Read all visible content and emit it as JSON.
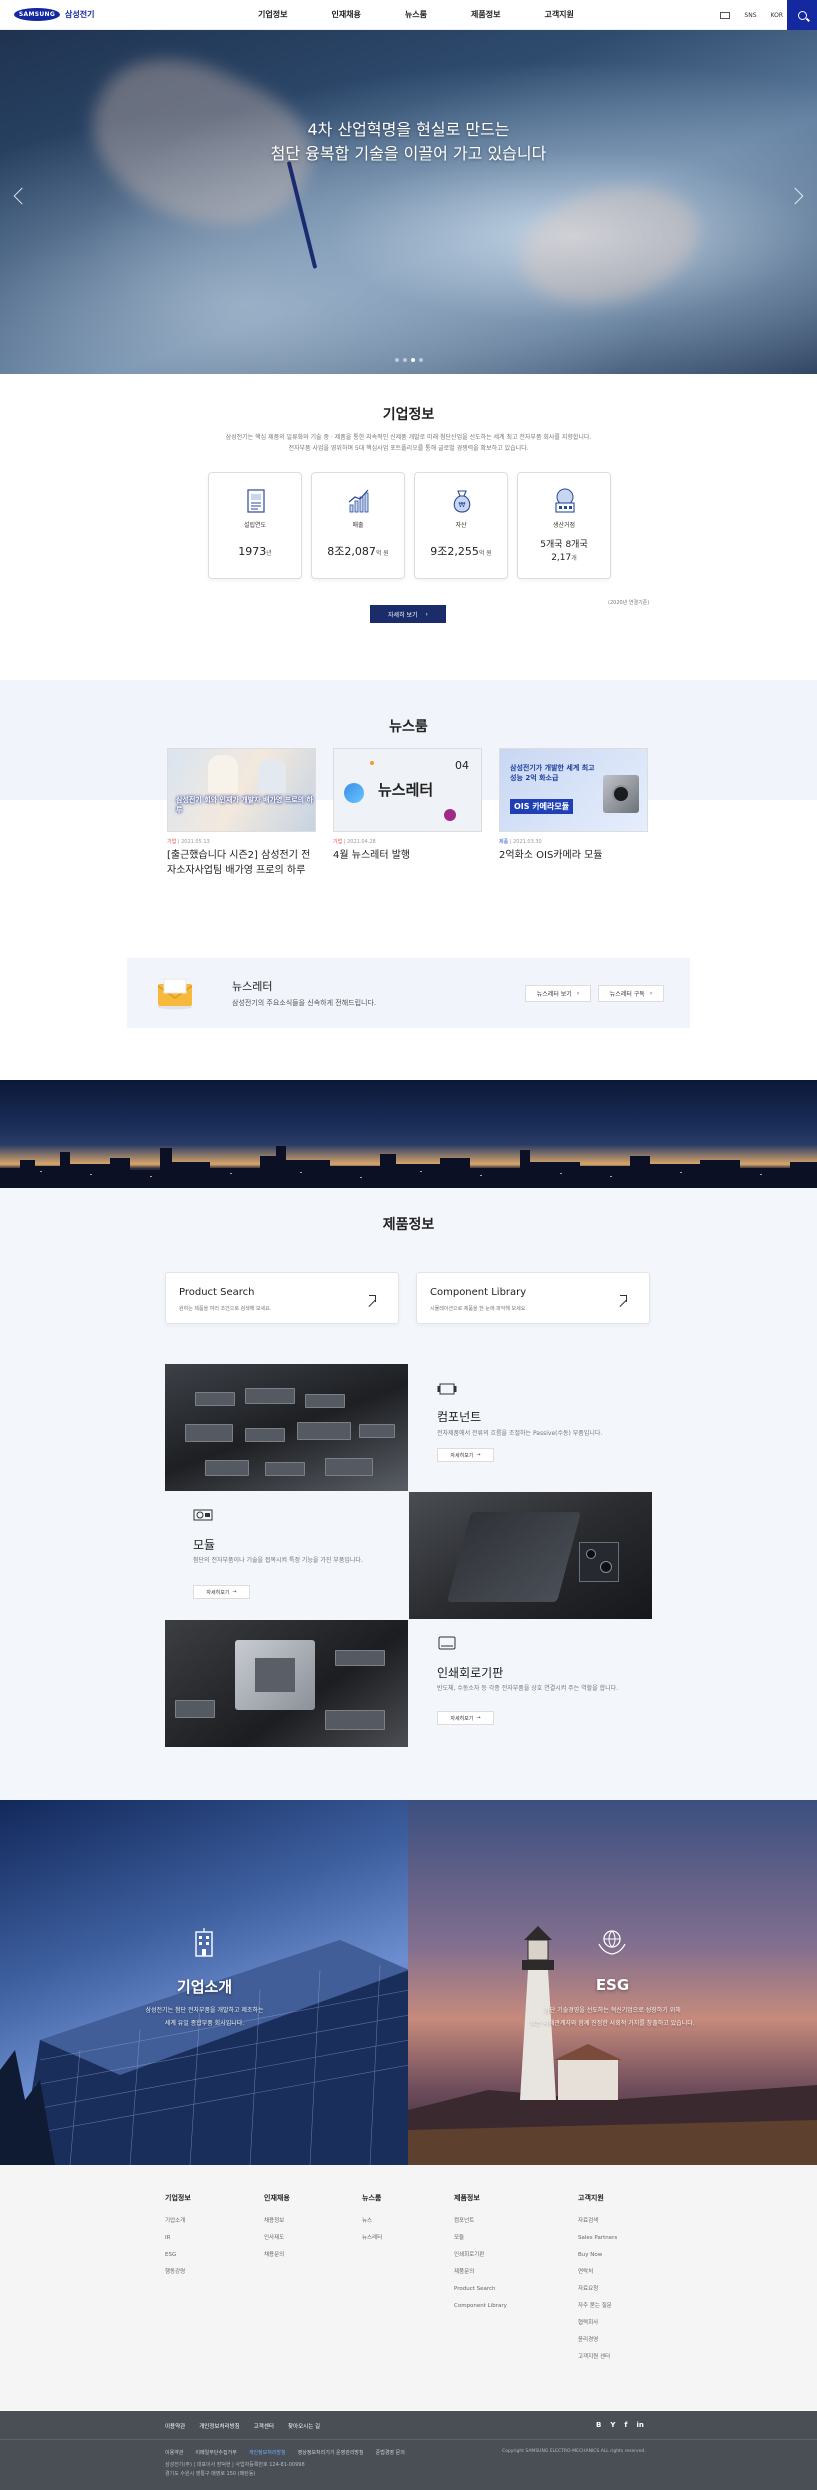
{
  "header": {
    "logo_brand": "SAMSUNG",
    "logo_text": "삼성전기",
    "gnb": [
      "기업정보",
      "인재채용",
      "뉴스룸",
      "제품정보",
      "고객지원"
    ],
    "utils": [
      "SNS",
      "KOR"
    ],
    "accent_color": "#1428a0"
  },
  "hero": {
    "title_line1": "4차 산업혁명을 현실로 만드는",
    "title_line2": "첨단 융복합 기술을 이끌어 가고 있습니다",
    "slides_total": 4,
    "slide_active": 3
  },
  "corp_info": {
    "title": "기업정보",
    "desc_line1": "삼성전기는 핵심 제품의 일류화와 기술 중 · 제품을 통한 지속적인 신제품 개발로 미래 첨단산업을 선도하는 세계 최고 전자부품 회사를 지향합니다.",
    "desc_line2": "전자부품 사업을 영위하며 5대 핵심사업 포트폴리오를 통해 글로벌 경쟁력을 확보하고 있습니다.",
    "cards": [
      {
        "label": "설립연도",
        "value": "1973",
        "unit": "년",
        "icon": "document-icon"
      },
      {
        "label": "매출",
        "value": "8조2,087",
        "unit": "억 원",
        "icon": "chart-icon"
      },
      {
        "label": "자산",
        "value": "9조2,255",
        "unit": "억 원",
        "icon": "money-bag-icon"
      },
      {
        "label": "생산거점",
        "value": "5개국",
        "value2": "8개국",
        "value3": "2,17",
        "unit3": "개",
        "icon": "factory-icon"
      }
    ],
    "note": "(2020년 연결기준)",
    "more_label": "자세히 보기"
  },
  "newsroom": {
    "title": "뉴스룸",
    "items": [
      {
        "category": "기업",
        "date": "2021.05.13",
        "title": "[출근했습니다 시즌2] 삼성전기 전자소자사업팀 배가영 프로의 하루",
        "thumb_text": "삼성전기 회와 인재가 개발자 배가영 프로의 하루"
      },
      {
        "category": "기업",
        "date": "2021.04.28",
        "title": "4월 뉴스레터 발행",
        "thumb_text": "뉴스레터",
        "thumb_num": "04"
      },
      {
        "category": "제품",
        "date": "2021.03.30",
        "title": "2억화소 OIS카메라 모듈",
        "thumb_text": "삼성전기가 개발한 세계 최고 성능 2억 화소급",
        "thumb_badge": "OIS 카메라모듈"
      }
    ]
  },
  "newsletter": {
    "title": "뉴스레터",
    "desc": "삼성전기의 주요소식들을 신속하게 전해드립니다.",
    "btn_view": "뉴스레터 보기",
    "btn_subscribe": "뉴스레터 구독"
  },
  "products": {
    "title": "제품정보",
    "search_cards": [
      {
        "title": "Product Search",
        "desc": "원하는 제품을 여러 조건으로 검색해 보세요."
      },
      {
        "title": "Component Library",
        "desc": "시뮬레이션으로 제품을 한 눈에 파악해 보세요."
      }
    ],
    "items": [
      {
        "title": "컴포넌트",
        "desc": "전자제품에서 전류의 흐름을 조절하는 Passive(수동) 부품입니다.",
        "btn": "자세히보기"
      },
      {
        "title": "모듈",
        "desc": "첨단의 전자부품이나 기술을 접목시켜 특정 기능을 가진 부품입니다.",
        "btn": "자세히보기"
      },
      {
        "title": "인쇄회로기판",
        "desc": "반도체, 수동소자 등 각종 전자부품을 상호 연결시켜 주는 역할을 합니다.",
        "btn": "자세히보기"
      }
    ]
  },
  "banners": [
    {
      "title": "기업소개",
      "desc_line1": "삼성전기는 첨단 전자부품을 개발하고 제조하는",
      "desc_line2": "세계 유일 종합부품 회사입니다."
    },
    {
      "title": "ESG",
      "desc_line1": "첨단 기술경영을 선도하는 혁신기업으로 성장하기 위해",
      "desc_line2": "모든 이해관계자와 함께 진정한 사회적 가치를 창출하고 있습니다."
    }
  ],
  "sitemap": [
    {
      "head": "기업정보",
      "links": [
        "기업소개",
        "IR",
        "ESG",
        "행동강령"
      ]
    },
    {
      "head": "인재채용",
      "links": [
        "채용정보",
        "인사제도",
        "채용문의"
      ]
    },
    {
      "head": "뉴스룸",
      "links": [
        "뉴스",
        "뉴스레터"
      ]
    },
    {
      "head": "제품정보",
      "links": [
        "컴포넌트",
        "모듈",
        "인쇄회로기판",
        "제품문의",
        "Product Search",
        "Component Library"
      ]
    },
    {
      "head": "고객지원",
      "links": [
        "자료검색",
        "Sales Partners",
        "Buy Now",
        "연락처",
        "자료요청",
        "자주 묻는 질문",
        "협력회사",
        "윤리경영",
        "고객지원 센터"
      ]
    }
  ],
  "footer": {
    "links": [
      "이용약관",
      "개인정보처리방침",
      "고객센터",
      "찾아오시는 길"
    ],
    "sns": [
      "B",
      "Y",
      "f",
      "in"
    ],
    "row1": [
      "이용약관",
      "이메일무단수집거부",
      "개인정보처리방침",
      "영상정보처리기기 운영관리방침",
      "준법경영 문의"
    ],
    "addr_line1": "삼성전기(주) | 대표이사 장덕현 | 사업자등록번호 124-81-00998",
    "addr_line2": "경기도 수원시 영통구 매영로 150 (매탄동)",
    "copyright": "Copyright SAMSUNG ELECTRO-MECHANICS ALL rights reserved."
  }
}
